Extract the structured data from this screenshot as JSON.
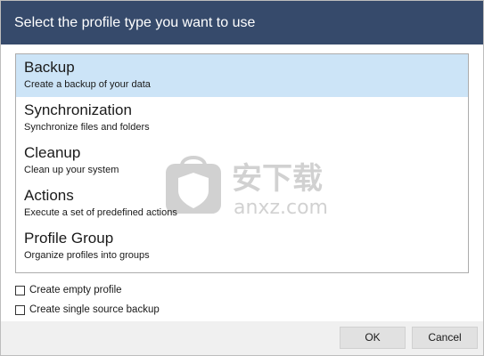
{
  "dialog": {
    "title": "Select the profile type you want to use"
  },
  "profiles": {
    "selected_index": 0,
    "items": [
      {
        "title": "Backup",
        "description": "Create a backup of your data"
      },
      {
        "title": "Synchronization",
        "description": "Synchronize files and folders"
      },
      {
        "title": "Cleanup",
        "description": "Clean up your system"
      },
      {
        "title": "Actions",
        "description": "Execute a set of predefined actions"
      },
      {
        "title": "Profile Group",
        "description": "Organize profiles into groups"
      }
    ]
  },
  "options": {
    "empty_profile": {
      "label": "Create empty profile",
      "checked": false
    },
    "single_source": {
      "label": "Create single source backup",
      "checked": false
    }
  },
  "buttons": {
    "ok_label": "OK",
    "cancel_label": "Cancel"
  },
  "watermark": {
    "text_cn": "安下载",
    "text_en": "anxz.com",
    "icon": "shield-bag-icon"
  },
  "colors": {
    "title_bar": "#364a6b",
    "selection": "#cce4f7"
  }
}
